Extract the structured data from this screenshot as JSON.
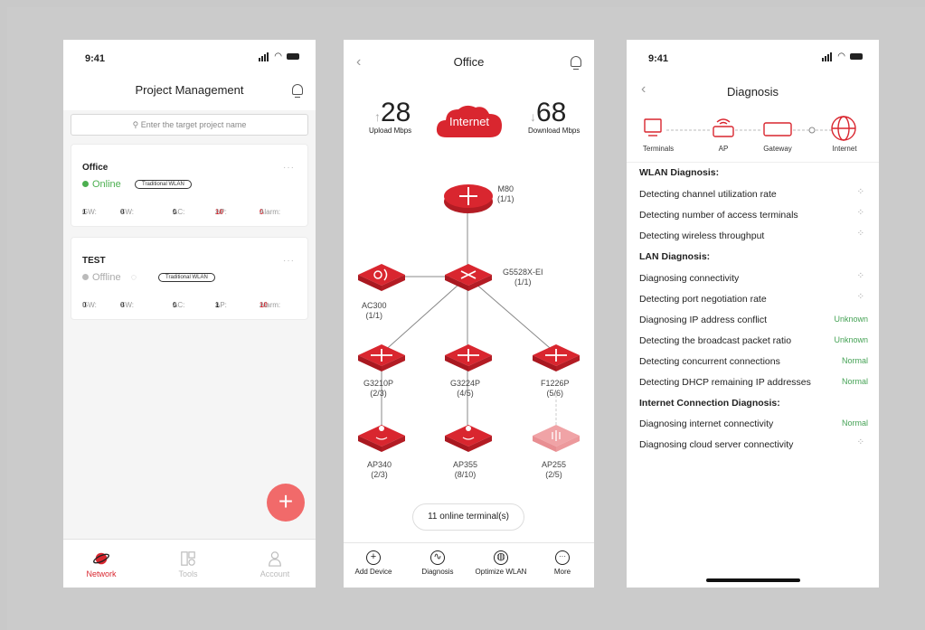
{
  "colors": {
    "brand_red": "#d9262f",
    "online_green": "#4caf50",
    "normal_green": "#45a255",
    "fab_red": "#f16a6a"
  },
  "panel1": {
    "time": "9:41",
    "title": "Project Management",
    "search_placeholder": "Enter the target project name",
    "projects": [
      {
        "name": "Office",
        "status": "Online",
        "tag": "Traditional WLAN",
        "gw_label": "GW:",
        "gw": "1",
        "sw_label": "SW:",
        "sw": "0",
        "ac_label": "AC:",
        "ac": "0",
        "ap_label": "AP:",
        "ap": "10",
        "alarm_label": "Alarm:",
        "alarm": "0"
      },
      {
        "name": "TEST",
        "status": "Offline",
        "tag": "Traditional WLAN",
        "gw_label": "GW:",
        "gw": "0",
        "sw_label": "SW:",
        "sw": "0",
        "ac_label": "AC:",
        "ac": "0",
        "ap_label": "AP:",
        "ap": "1",
        "alarm_label": "Alarm:",
        "alarm": "10"
      }
    ],
    "fab": "+",
    "tabs": [
      {
        "label": "Network",
        "icon": "planet-icon"
      },
      {
        "label": "Tools",
        "icon": "tools-icon"
      },
      {
        "label": "Account",
        "icon": "account-icon"
      }
    ]
  },
  "panel2": {
    "title": "Office",
    "upload_value": "28",
    "upload_label": "Upload Mbps",
    "cloud_label": "Internet",
    "download_value": "68",
    "download_label": "Download Mbps",
    "nodes": {
      "m80": {
        "name": "M80",
        "count": "(1/1)"
      },
      "core": {
        "name": "G5528X-EI",
        "count": "(1/1)"
      },
      "ac": {
        "name": "AC300",
        "count": "(1/1)"
      },
      "sw1": {
        "name": "G3210P",
        "count": "(2/3)"
      },
      "sw2": {
        "name": "G3224P",
        "count": "(4/5)"
      },
      "sw3": {
        "name": "F1226P",
        "count": "(5/6)"
      },
      "ap1": {
        "name": "AP340",
        "count": "(2/3)"
      },
      "ap2": {
        "name": "AP355",
        "count": "(8/10)"
      },
      "ap3": {
        "name": "AP255",
        "count": "(2/5)"
      }
    },
    "terminals": "11 online terminal(s)",
    "tabs": [
      {
        "label": "Add Device",
        "icon": "plus-circle-icon",
        "glyph": "+"
      },
      {
        "label": "Diagnosis",
        "icon": "pulse-icon",
        "glyph": "∿"
      },
      {
        "label": "Optimize WLAN",
        "icon": "optimize-icon",
        "glyph": "◍"
      },
      {
        "label": "More",
        "icon": "more-icon",
        "glyph": "···"
      }
    ]
  },
  "panel3": {
    "time": "9:41",
    "title": "Diagnosis",
    "topology": [
      "Terminals",
      "AP",
      "Gateway",
      "Internet"
    ],
    "sections": [
      {
        "heading": "WLAN Diagnosis:",
        "rows": [
          {
            "label": "Detecting channel utilization rate",
            "value": ""
          },
          {
            "label": "Detecting number of access terminals",
            "value": ""
          },
          {
            "label": "Detecting wireless throughput",
            "value": ""
          }
        ]
      },
      {
        "heading": "LAN Diagnosis:",
        "rows": [
          {
            "label": "Diagnosing connectivity",
            "value": ""
          },
          {
            "label": "Detecting port negotiation rate",
            "value": ""
          },
          {
            "label": "Diagnosing IP address conflict",
            "value": "Unknown"
          },
          {
            "label": "Detecting the broadcast packet ratio",
            "value": "Unknown"
          },
          {
            "label": "Detecting concurrent connections",
            "value": "Normal"
          },
          {
            "label": "Detecting DHCP remaining IP addresses",
            "value": "Normal"
          }
        ]
      },
      {
        "heading": "Internet Connection Diagnosis:",
        "rows": [
          {
            "label": "Diagnosing internet connectivity",
            "value": "Normal"
          },
          {
            "label": "Diagnosing cloud server connectivity",
            "value": ""
          }
        ]
      }
    ]
  }
}
